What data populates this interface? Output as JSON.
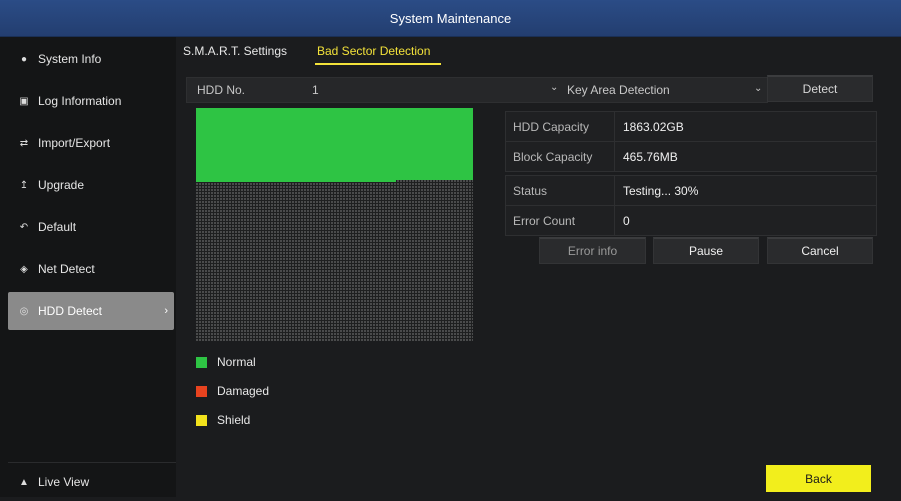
{
  "window": {
    "title": "System Maintenance"
  },
  "sidebar": {
    "items": [
      {
        "label": "System Info",
        "icon": "info-icon"
      },
      {
        "label": "Log Information",
        "icon": "log-icon"
      },
      {
        "label": "Import/Export",
        "icon": "import-export-icon"
      },
      {
        "label": "Upgrade",
        "icon": "upgrade-icon"
      },
      {
        "label": "Default",
        "icon": "default-icon"
      },
      {
        "label": "Net Detect",
        "icon": "network-icon"
      },
      {
        "label": "HDD Detect",
        "icon": "hdd-icon",
        "active": true
      }
    ],
    "live_view": {
      "label": "Live View",
      "icon": "home-icon"
    }
  },
  "tabs": [
    {
      "label": "S.M.A.R.T. Settings",
      "active": false
    },
    {
      "label": "Bad Sector Detection",
      "active": true
    }
  ],
  "hdd": {
    "label": "HDD No.",
    "value": "1",
    "detection_mode": "Key Area Detection",
    "detect_label": "Detect"
  },
  "info": {
    "hdd_capacity_label": "HDD Capacity",
    "hdd_capacity": "1863.02GB",
    "block_capacity_label": "Block Capacity",
    "block_capacity": "465.76MB",
    "status_label": "Status",
    "status": "Testing... 30%",
    "error_count_label": "Error Count",
    "error_count": "0"
  },
  "actions": {
    "error_info": "Error info",
    "pause": "Pause",
    "cancel": "Cancel",
    "back": "Back"
  },
  "legend": [
    {
      "label": "Normal",
      "color": "#2ec444"
    },
    {
      "label": "Damaged",
      "color": "#e8431f"
    },
    {
      "label": "Shield",
      "color": "#f2e21c"
    }
  ],
  "colors": {
    "titlebar": "#2b4c86",
    "active_tab": "#f3e23a",
    "back_button": "#f2ee1c"
  }
}
